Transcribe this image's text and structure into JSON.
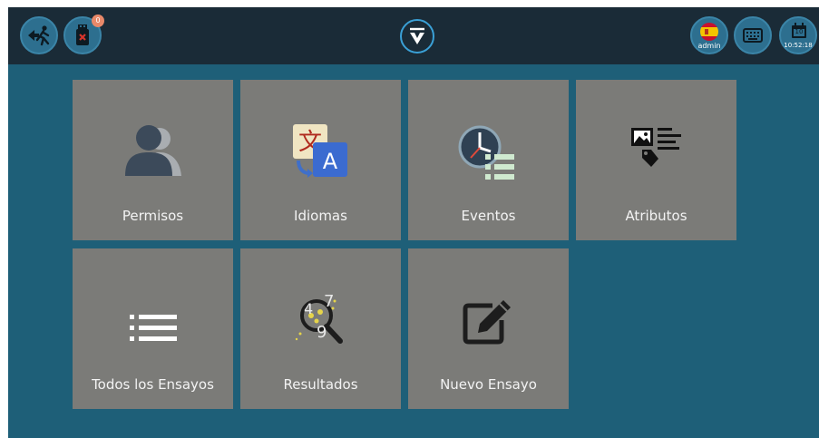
{
  "topbar": {
    "exit_icon": "exit-run-icon",
    "usb_icon": "usb-drive-icon",
    "usb_badge": "0",
    "logo_icon": "v-logo-icon",
    "language_flag_icon": "spain-flag-icon",
    "user_label": "admin",
    "keyboard_icon": "keyboard-icon",
    "calendar_icon": "calendar-icon",
    "calendar_day": "10",
    "clock": "10:52:18"
  },
  "tiles": [
    {
      "label": "Permisos",
      "icon": "users-icon"
    },
    {
      "label": "Idiomas",
      "icon": "translate-icon"
    },
    {
      "label": "Eventos",
      "icon": "clock-list-icon"
    },
    {
      "label": "Atributos",
      "icon": "attributes-icon"
    },
    {
      "label": "Todos los Ensayos",
      "icon": "list-icon"
    },
    {
      "label": "Resultados",
      "icon": "results-search-icon"
    },
    {
      "label": "Nuevo Ensayo",
      "icon": "edit-icon"
    }
  ],
  "colors": {
    "background": "#1e5f78",
    "topbar": "#1a2b37",
    "tile": "#7b7b78",
    "accent": "#3aa0d6"
  }
}
